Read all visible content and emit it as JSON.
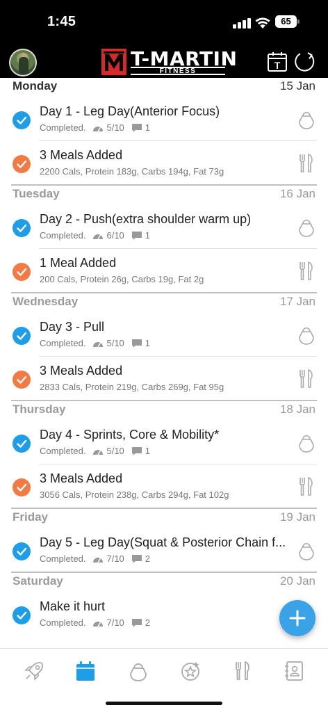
{
  "status_bar": {
    "time": "1:45",
    "battery": "65"
  },
  "header": {
    "brand_title": "T-MARTIN",
    "brand_subtitle": "FITNESS",
    "calendar_letter": "T"
  },
  "days": [
    {
      "name": "Monday",
      "date": "15 Jan",
      "items": [
        {
          "kind": "workout",
          "title": "Day 1 - Leg Day(Anterior Focus)",
          "status": "Completed.",
          "rating": "5/10",
          "comments": "1"
        },
        {
          "kind": "meal",
          "title": "3 Meals Added",
          "detail": "2200 Cals, Protein 183g, Carbs 194g, Fat 73g"
        }
      ]
    },
    {
      "name": "Tuesday",
      "date": "16 Jan",
      "items": [
        {
          "kind": "workout",
          "title": "Day 2 - Push(extra shoulder warm up)",
          "status": "Completed.",
          "rating": "6/10",
          "comments": "1"
        },
        {
          "kind": "meal",
          "title": "1 Meal Added",
          "detail": "200 Cals, Protein 26g, Carbs 19g, Fat 2g"
        }
      ]
    },
    {
      "name": "Wednesday",
      "date": "17 Jan",
      "items": [
        {
          "kind": "workout",
          "title": "Day 3 - Pull",
          "status": "Completed.",
          "rating": "5/10",
          "comments": "1"
        },
        {
          "kind": "meal",
          "title": "3 Meals Added",
          "detail": "2833 Cals, Protein 219g, Carbs 269g, Fat 95g"
        }
      ]
    },
    {
      "name": "Thursday",
      "date": "18 Jan",
      "items": [
        {
          "kind": "workout",
          "title": "Day 4 - Sprints, Core & Mobility*",
          "status": "Completed.",
          "rating": "5/10",
          "comments": "1"
        },
        {
          "kind": "meal",
          "title": "3 Meals Added",
          "detail": "3056 Cals, Protein 238g, Carbs 294g, Fat 102g"
        }
      ]
    },
    {
      "name": "Friday",
      "date": "19 Jan",
      "items": [
        {
          "kind": "workout",
          "title": "Day 5 - Leg Day(Squat & Posterior Chain f...",
          "status": "Completed.",
          "rating": "7/10",
          "comments": "2"
        }
      ]
    },
    {
      "name": "Saturday",
      "date": "20 Jan",
      "items": [
        {
          "kind": "workout",
          "title": "Make it hurt",
          "status": "Completed.",
          "rating": "7/10",
          "comments": "2"
        }
      ]
    }
  ],
  "tabs": [
    {
      "icon": "rocket-icon",
      "active": false
    },
    {
      "icon": "calendar-icon",
      "active": true
    },
    {
      "icon": "kettlebell-icon",
      "active": false
    },
    {
      "icon": "achievement-icon",
      "active": false
    },
    {
      "icon": "fork-knife-icon",
      "active": false
    },
    {
      "icon": "contact-book-icon",
      "active": false
    }
  ],
  "colors": {
    "workout_check": "#1e9de8",
    "meal_check": "#f27a45",
    "active_tab": "#1e9de8",
    "brand_red": "#d42a2a",
    "fab": "#3aa3e8"
  }
}
